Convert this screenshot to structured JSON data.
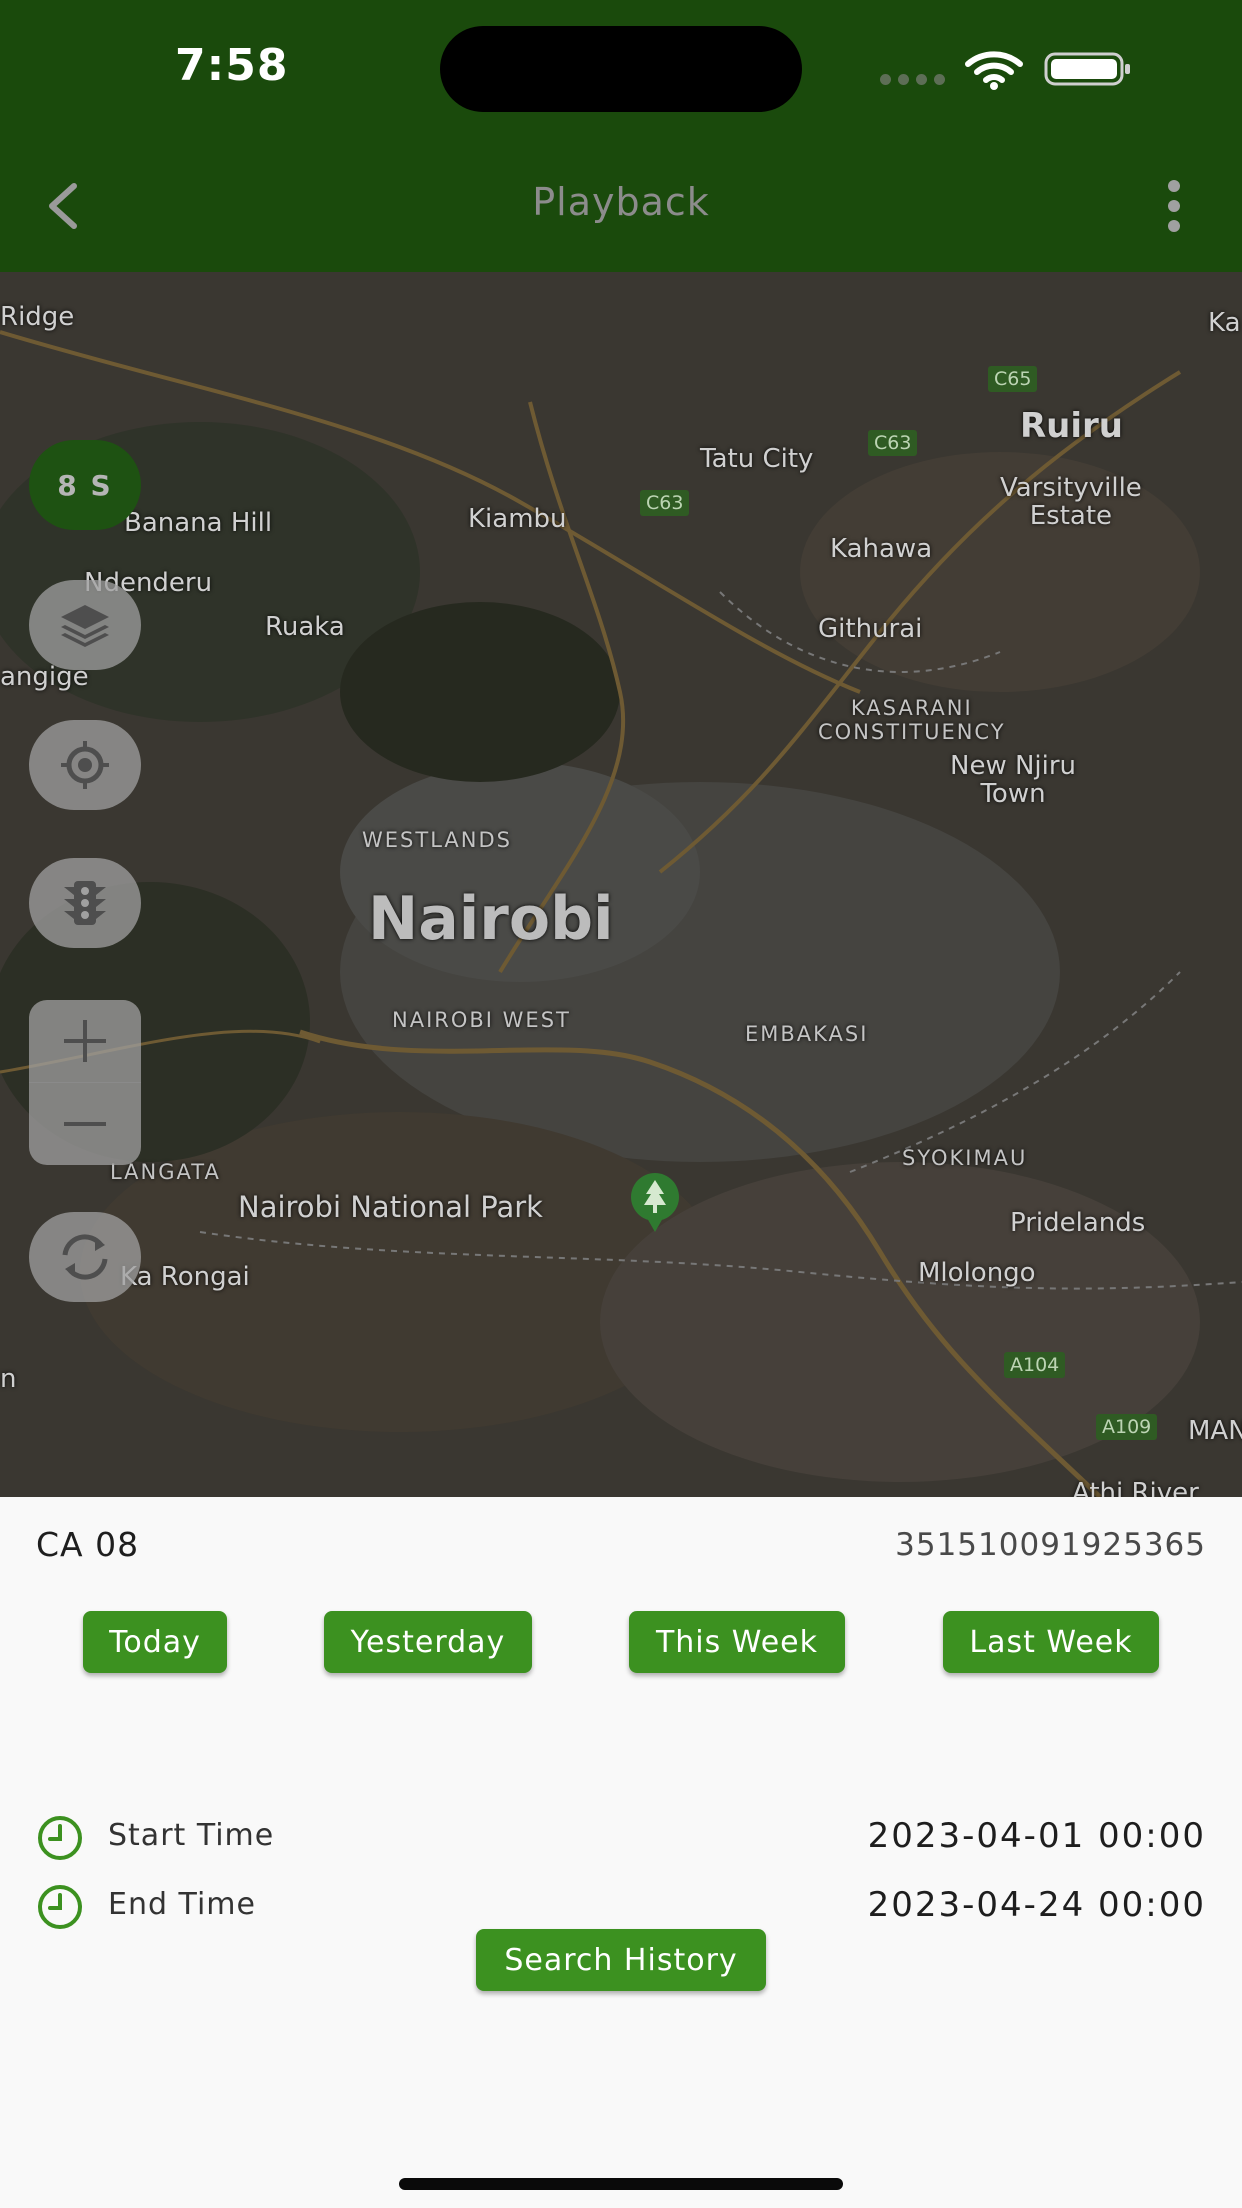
{
  "status_bar": {
    "time": "7:58"
  },
  "header": {
    "title": "Playback",
    "back_icon": "chevron-left-icon",
    "menu_icon": "more-vertical-icon"
  },
  "colors": {
    "header_bg": "#1a4a0c",
    "accent_green": "#3c9120",
    "speed_bg": "#1e5212"
  },
  "map": {
    "speed_label": "8 S",
    "controls": [
      "layers-icon",
      "locate-icon",
      "traffic-light-icon",
      "zoom-in-icon",
      "zoom-out-icon",
      "refresh-icon"
    ],
    "places": {
      "ridge": "Ridge",
      "ka": "Ka",
      "ruiru": "Ruiru",
      "tatu_city": "Tatu City",
      "banana_hill": "Banana Hill",
      "kiambu": "Kiambu",
      "varsityville": "Varsityville\nEstate",
      "kahawa": "Kahawa",
      "ndenderu": "Ndenderu",
      "ruaka": "Ruaka",
      "githurai": "Githurai",
      "angige": "angige",
      "kasarani": "KASARANI\nCONSTITUENCY",
      "new_njiru": "New Njiru\nTown",
      "westlands": "WESTLANDS",
      "nairobi": "Nairobi",
      "nairobi_west": "NAIROBI WEST",
      "embakasi": "EMBAKASI",
      "langata": "LANGATA",
      "syokimau": "SYOKIMAU",
      "national_park": "Nairobi National Park",
      "pridelands": "Pridelands",
      "ka_rongai": "Ka Rongai",
      "mlolongo": "Mlolongo",
      "athi_river": "Athi River",
      "man": "MAN",
      "n": "n"
    },
    "roads": {
      "c65": "C65",
      "c63a": "C63",
      "c63b": "C63",
      "a104": "A104",
      "a109": "A109"
    }
  },
  "panel": {
    "device_name": "CA 08",
    "device_imei": "351510091925365",
    "quick_ranges": [
      "Today",
      "Yesterday",
      "This Week",
      "Last Week"
    ],
    "start_label": "Start Time",
    "start_value": "2023-04-01 00:00",
    "end_label": "End Time",
    "end_value": "2023-04-24 00:00",
    "search_label": "Search History"
  }
}
